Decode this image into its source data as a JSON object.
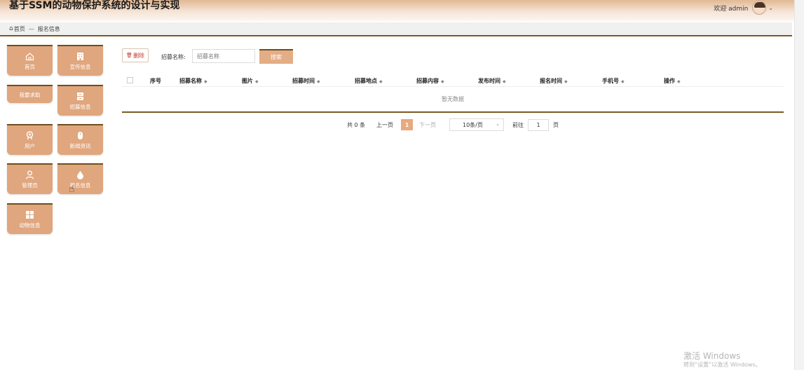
{
  "header": {
    "title": "基于SSM的动物保护系统的设计与实现",
    "welcome": "欢迎 admin",
    "avatar_icon": "user-avatar",
    "dropdown_icon": "chevron-down-icon"
  },
  "breadcrumb": {
    "home": "首页",
    "separator": "—",
    "current": "报名信息"
  },
  "sidebar": {
    "tiles": [
      {
        "label": "首页",
        "icon": "home-icon"
      },
      {
        "label": "宣传信息",
        "icon": "building-icon"
      },
      {
        "label": "我要求助",
        "icon": ""
      },
      {
        "label": "招募信息",
        "icon": "cabinet-icon"
      },
      {
        "label": "用户",
        "icon": "user-badge-icon"
      },
      {
        "label": "新闻资讯",
        "icon": "mouse-icon"
      },
      {
        "label": "管理员",
        "icon": "person-icon"
      },
      {
        "label": "报名信息",
        "icon": "droplet-icon"
      },
      {
        "label": "动物信息",
        "icon": "grid-icon"
      }
    ]
  },
  "toolbar": {
    "delete_label": "删除",
    "search_label": "招募名称:",
    "search_placeholder": "招募名称",
    "search_button": "搜索"
  },
  "table": {
    "columns": [
      "序号",
      "招募名称",
      "图片",
      "招募时间",
      "招募地点",
      "招募内容",
      "发布时间",
      "报名时间",
      "手机号",
      "操作"
    ],
    "empty_text": "暂无数据"
  },
  "pagination": {
    "total": "共 0 条",
    "prev": "上一页",
    "current_page": "1",
    "next": "下一页",
    "page_size": "10条/页",
    "goto_label": "前往",
    "goto_value": "1",
    "page_suffix": "页"
  },
  "watermark": {
    "title": "激活 Windows",
    "subtitle": "转到“设置”以激活 Windows。"
  },
  "colors": {
    "accent": "#e0a67d",
    "border_dark": "#7a5a22",
    "header_top": "#e2b994"
  }
}
